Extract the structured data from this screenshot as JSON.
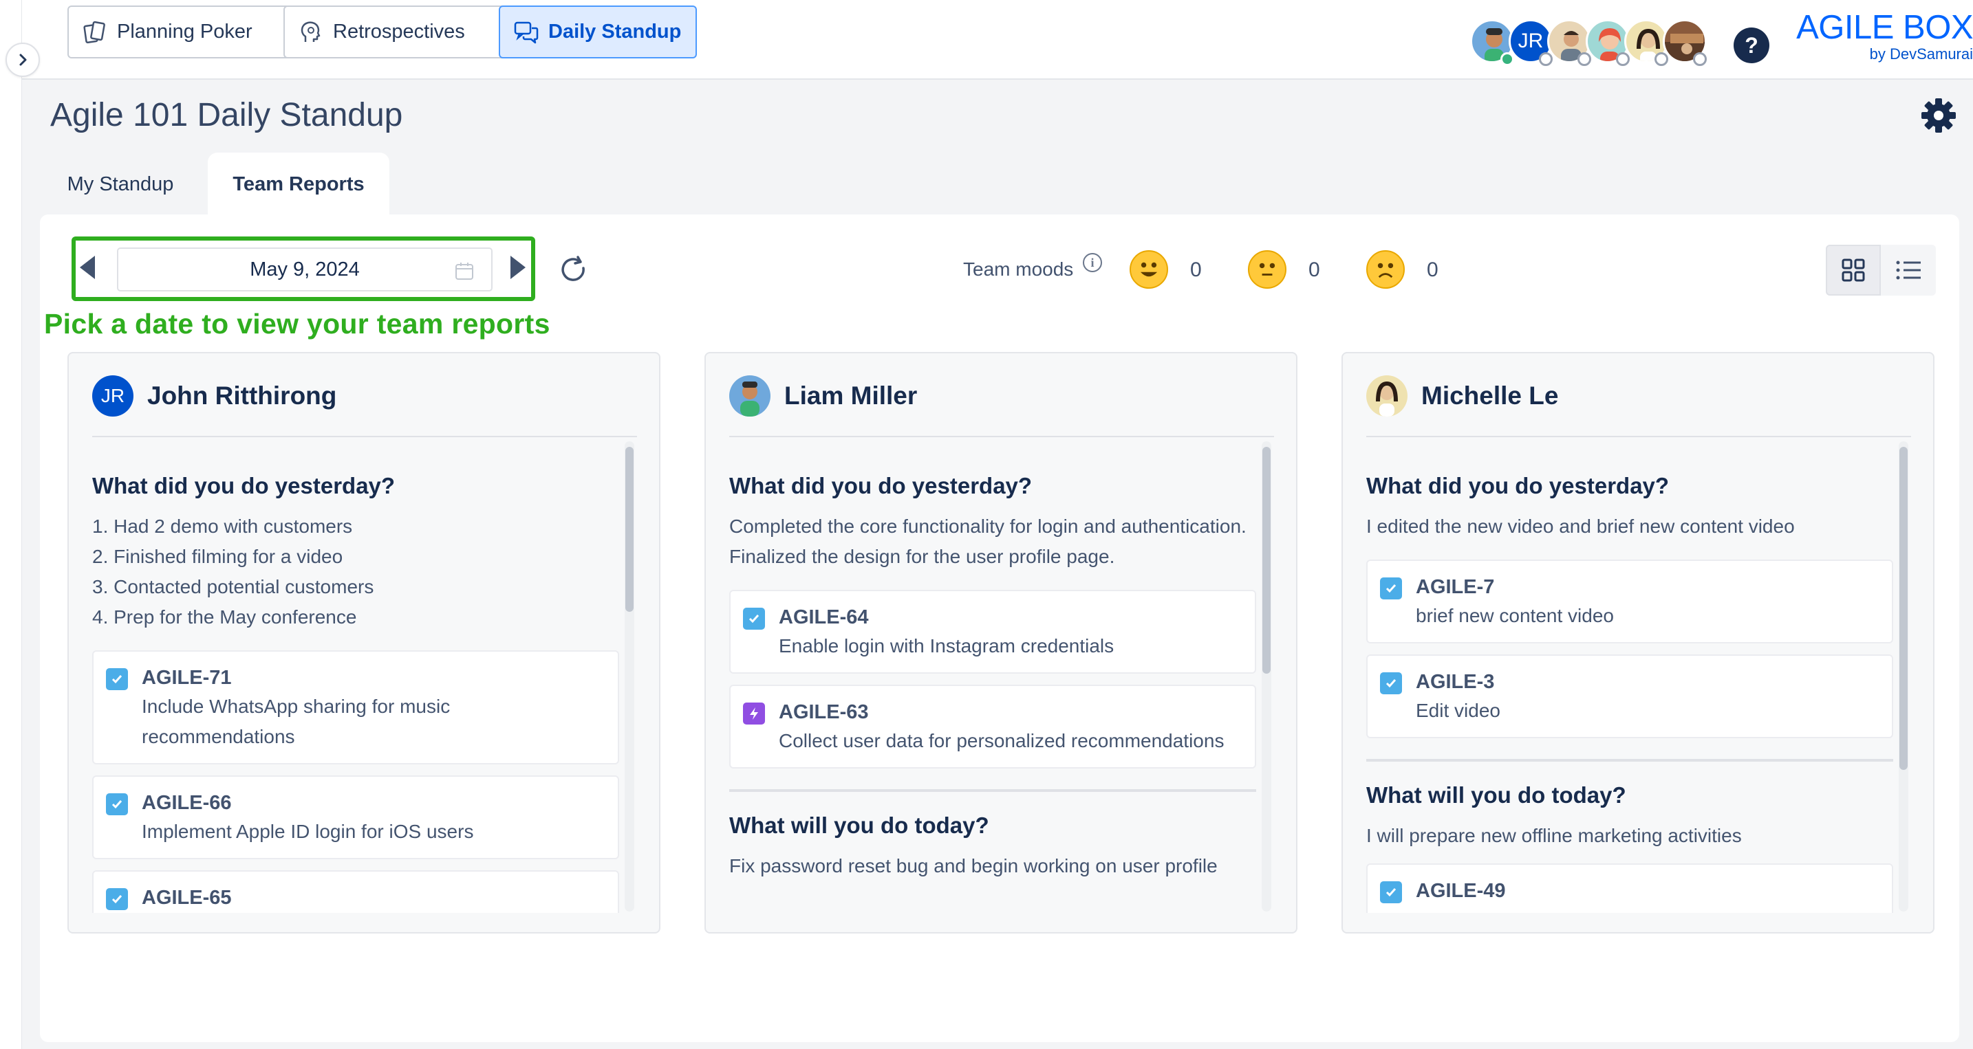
{
  "nav": {
    "planning_poker": "Planning Poker",
    "retrospectives": "Retrospectives",
    "daily_standup": "Daily Standup"
  },
  "brand": {
    "title": "AGILE BOX",
    "subtitle": "by DevSamurai"
  },
  "header": {
    "help": "?",
    "avatar_initials": "JR"
  },
  "page": {
    "title": "Agile 101 Daily Standup"
  },
  "tabs": {
    "my_standup": "My Standup",
    "team_reports": "Team Reports"
  },
  "toolbar": {
    "date": "May 9, 2024",
    "hint": "Pick a date to view your team reports",
    "moods_label": "Team moods",
    "moods": [
      {
        "icon": "smiling-face-icon",
        "count": "0"
      },
      {
        "icon": "neutral-face-icon",
        "count": "0"
      },
      {
        "icon": "frowning-face-icon",
        "count": "0"
      }
    ]
  },
  "colors": {
    "accent": "#0065ff",
    "highlight": "#2fae1f",
    "story": "#4bade8",
    "epic": "#904ee2"
  },
  "cards": [
    {
      "name": "John Ritthirong",
      "initials": "JR",
      "q1": "What did you do yesterday?",
      "a1": [
        "1. Had 2 demo with customers",
        "2. Finished filming for a video",
        "3. Contacted potential customers",
        "4. Prep for the May conference"
      ],
      "issues": [
        {
          "key": "AGILE-71",
          "summary": "Include WhatsApp sharing for music recommendations"
        },
        {
          "key": "AGILE-66",
          "summary": "Implement Apple ID login for iOS users"
        },
        {
          "key": "AGILE-65",
          "summary": ""
        }
      ]
    },
    {
      "name": "Liam Miller",
      "q1": "What did you do yesterday?",
      "a1": [
        "Completed the core functionality for login and authentication.",
        "Finalized the design for the user profile page."
      ],
      "issues": [
        {
          "key": "AGILE-64",
          "summary": "Enable login with Instagram credentials"
        },
        {
          "key": "AGILE-63",
          "summary": "Collect user data for personalized recommendations"
        }
      ],
      "q2": "What will you do today?",
      "a2": "Fix password reset bug and begin working on user profile"
    },
    {
      "name": "Michelle Le",
      "q1": "What did you do yesterday?",
      "a1": [
        "I edited the new video and brief new content video"
      ],
      "issues": [
        {
          "key": "AGILE-7",
          "summary": "brief new content video"
        },
        {
          "key": "AGILE-3",
          "summary": "Edit video"
        }
      ],
      "q2": "What will you do today?",
      "a2": "I will prepare new offline marketing activities",
      "issues2": [
        {
          "key": "AGILE-49",
          "summary": ""
        }
      ]
    }
  ]
}
